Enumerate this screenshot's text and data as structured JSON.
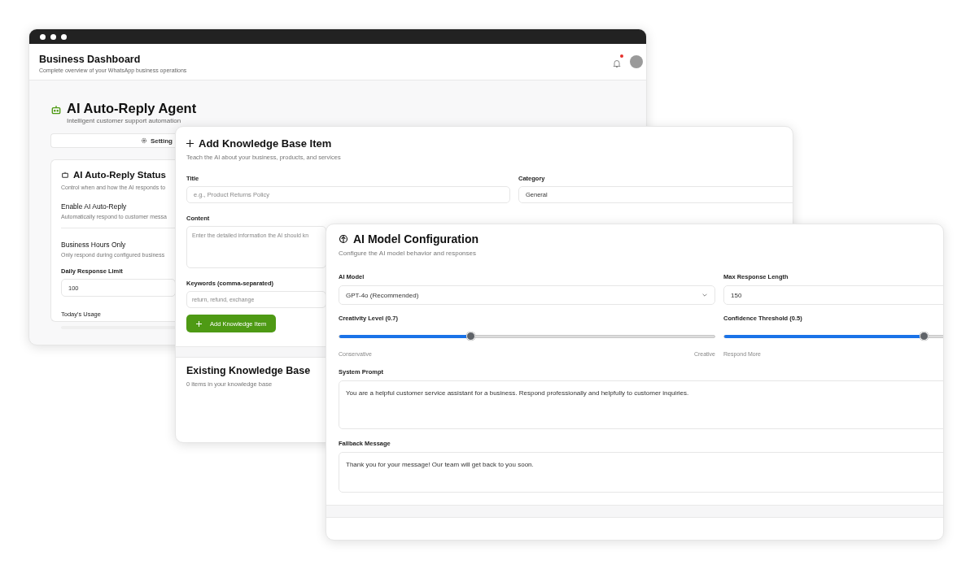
{
  "dashboard_window": {
    "title": "Business Dashboard",
    "subtitle": "Complete overview of your WhatsApp business operations",
    "notification_dot": true,
    "agent": {
      "title": "AI Auto-Reply Agent",
      "subtitle": "Intelligent customer support automation"
    },
    "tabs": [
      {
        "label": "Setting",
        "selected": true
      }
    ],
    "status_card": {
      "title": "AI Auto-Reply Status",
      "subtitle": "Control when and how the AI responds to",
      "settings": [
        {
          "label": "Enable AI Auto-Reply",
          "description": "Automatically respond to customer messa"
        },
        {
          "label": "Business Hours Only",
          "description": "Only respond during configured business"
        }
      ],
      "limit_label": "Daily Response Limit",
      "limit_value": "100",
      "usage_label": "Today's Usage",
      "usage": {
        "level": 0
      }
    }
  },
  "knowledge_window": {
    "title": "Add Knowledge Base Item",
    "subtitle": "Teach the AI about your business, products, and services",
    "fields": [
      {
        "label": "Title",
        "placeholder": "e.g., Product Returns Policy",
        "kind": "input"
      },
      {
        "label": "Category",
        "value": "General",
        "kind": "input"
      },
      {
        "label": "Content",
        "placeholder": "Enter the detailed information the AI should kn",
        "kind": "textarea"
      },
      {
        "label": "Keywords (comma-separated)",
        "placeholder": "return, refund, exchange",
        "kind": "input"
      }
    ],
    "button": "Add Knowledge Item",
    "existing": {
      "title": "Existing Knowledge Base",
      "subtitle": "0 items in your knowledge base"
    }
  },
  "model_window": {
    "title": "AI Model Configuration",
    "subtitle": "Configure the AI model behavior and responses",
    "model": {
      "label": "AI Model",
      "value": "GPT-4o (Recommended)"
    },
    "max_length": {
      "label": "Max Response Length",
      "value": "150"
    },
    "sliders": [
      {
        "label": "Creativity Level (0.7)",
        "level": 0.35,
        "min_label": "Conservative",
        "max_label": "Creative"
      },
      {
        "label": "Confidence Threshold (0.5)",
        "level": 0.85,
        "min_label": "Respond More"
      }
    ],
    "system_prompt": {
      "label": "System Prompt",
      "value": "You are a helpful customer service assistant for a business. Respond professionally and helpfully to customer inquiries."
    },
    "fallback": {
      "label": "Fallback Message",
      "value": "Thank you for your message! Our team will get back to you soon."
    }
  }
}
